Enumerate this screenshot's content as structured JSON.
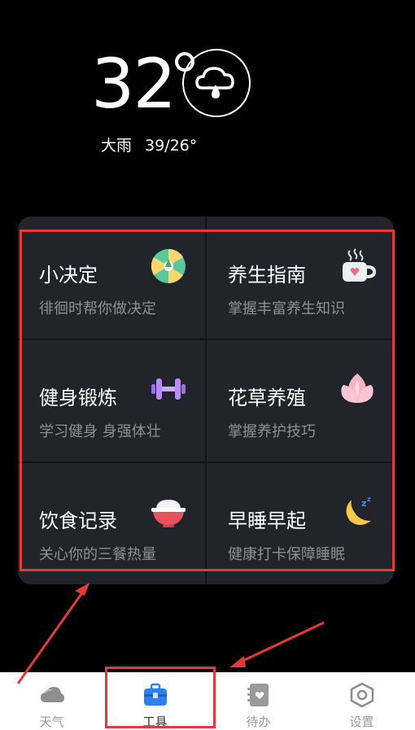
{
  "weather": {
    "temperature": "32",
    "condition": "大雨",
    "range": "39/26°"
  },
  "tools": [
    {
      "title": "小决定",
      "subtitle": "徘徊时帮你做决定",
      "icon": "wheel-icon"
    },
    {
      "title": "养生指南",
      "subtitle": "掌握丰富养生知识",
      "icon": "tea-cup-icon"
    },
    {
      "title": "健身锻炼",
      "subtitle": "学习健身 身强体壮",
      "icon": "dumbbell-icon"
    },
    {
      "title": "花草养殖",
      "subtitle": "掌握养护技巧",
      "icon": "lotus-icon"
    },
    {
      "title": "饮食记录",
      "subtitle": "关心你的三餐热量",
      "icon": "rice-bowl-icon"
    },
    {
      "title": "早睡早起",
      "subtitle": "健康打卡保障睡眠",
      "icon": "moon-sleep-icon"
    }
  ],
  "tabbar": {
    "items": [
      {
        "label": "天气",
        "icon": "cloud-icon"
      },
      {
        "label": "工具",
        "icon": "toolbox-icon"
      },
      {
        "label": "待办",
        "icon": "notebook-icon"
      },
      {
        "label": "设置",
        "icon": "hexagon-settings-icon"
      }
    ],
    "active": "工具"
  },
  "colors": {
    "background": "#000000",
    "card": "#22242b",
    "subtitle": "#8c8f96",
    "annotation_red": "#e53935",
    "tab_active": "#2f80ed"
  }
}
